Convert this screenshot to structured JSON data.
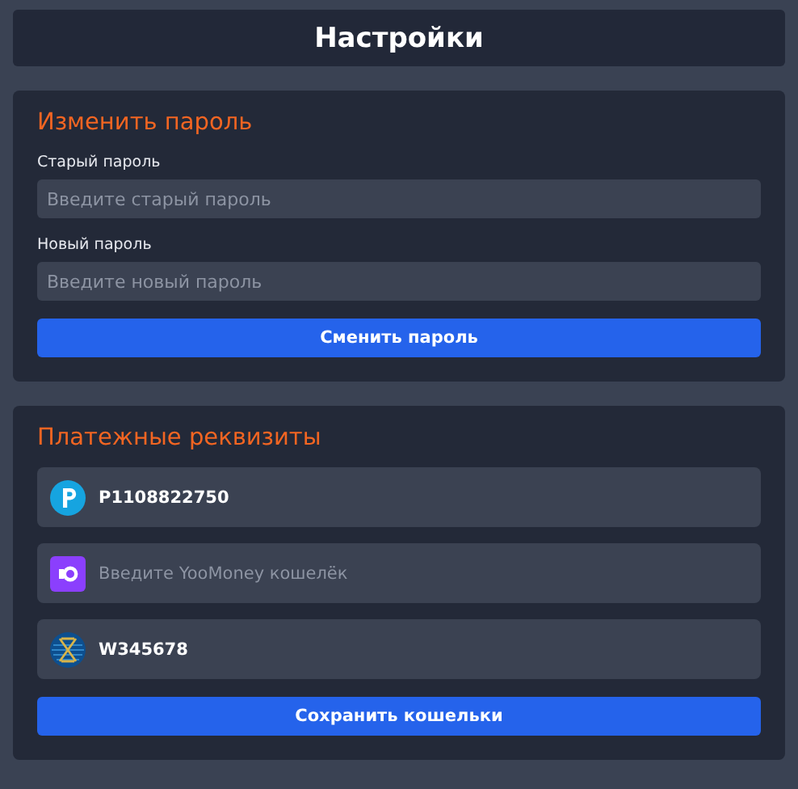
{
  "header": {
    "title": "Настройки"
  },
  "password_section": {
    "title": "Изменить пароль",
    "fields": [
      {
        "label": "Старый пароль",
        "placeholder": "Введите старый пароль"
      },
      {
        "label": "Новый пароль",
        "placeholder": "Введите новый пароль"
      }
    ],
    "button": "Сменить пароль"
  },
  "payment_section": {
    "title": "Платежные реквизиты",
    "wallets": [
      {
        "kind": "payeer",
        "value": "P1108822750"
      },
      {
        "kind": "yoomoney",
        "placeholder": "Введите YooMoney кошелёк"
      },
      {
        "kind": "webmoney",
        "value": "W345678"
      }
    ],
    "button": "Сохранить кошельки"
  }
}
